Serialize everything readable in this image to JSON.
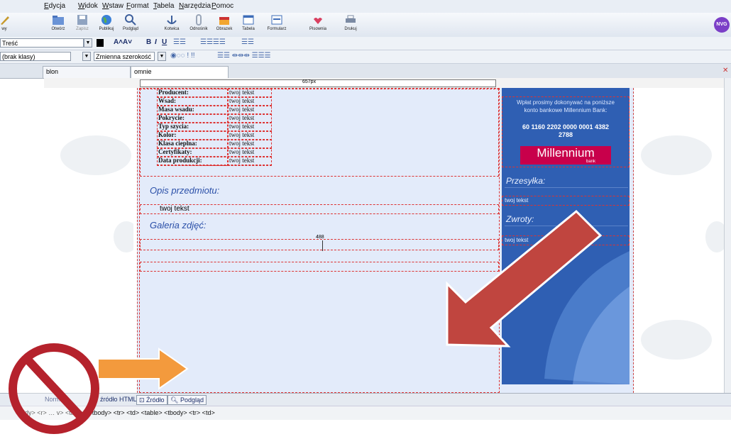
{
  "menu": [
    "Edycja",
    "Widok",
    "Wstaw",
    "Format",
    "Tabela",
    "Narzędzia",
    "Pomoc"
  ],
  "toolbar": {
    "items": [
      "Otwórz",
      "Zapisz",
      "Publikuj",
      "Podgląd",
      "Kotwica",
      "Odnośnik",
      "Obrazek",
      "Tabela",
      "Formularz",
      "Pisownia",
      "Drukuj"
    ],
    "partial_left": "wy",
    "user_badge": "NVG"
  },
  "format": {
    "paragraph_style": "Treść",
    "class_select": "(brak klasy)",
    "width_select": "Zmienna szerokość"
  },
  "tabs": [
    "blon",
    "omnie"
  ],
  "ruler": {
    "width_label": "657px",
    "cell_label": "488"
  },
  "product_specs": [
    {
      "label": "Producent:",
      "value": "twoj tekst"
    },
    {
      "label": "Wsad:",
      "value": "twoj tekst"
    },
    {
      "label": "Masa wsadu:",
      "value": "twoj tekst"
    },
    {
      "label": "Pokrycie:",
      "value": "twoj tekst"
    },
    {
      "label": "Typ szycia:",
      "value": "twoj tekst"
    },
    {
      "label": "Kolor:",
      "value": "twoj tekst"
    },
    {
      "label": "Klasa cieplna:",
      "value": "twoj tekst"
    },
    {
      "label": "Certyfikaty:",
      "value": "twoj tekst"
    },
    {
      "label": "Data produkcji:",
      "value": "twoj tekst"
    }
  ],
  "main": {
    "description_title": "Opis przedmiotu:",
    "description_text": "twoj tekst",
    "gallery_title": "Galeria zdjęć:"
  },
  "sidebar": {
    "payment_text_1": "Wpłat prosimy dokonywać na poniższe",
    "payment_text_2": "konto bankowe Millennium Bank:",
    "account_1": "60 1160 2202 0000 0001 4382",
    "account_2": "2788",
    "bank_logo": "Millennium",
    "bank_sub": "bank",
    "shipping_title": "Przesyłka:",
    "shipping_text": "twoj tekst",
    "returns_title": "Zwroty:",
    "returns_text": "twoj tekst"
  },
  "view_tabs": [
    "Norm",
    "źródło HTML",
    "Źródło",
    "Podgląd"
  ],
  "status_path": "ody> <r> … v> <table> <tbody> <tr> <td> <table> <tbody> <tr> <td>",
  "colors": {
    "page_bg": "#e3ebfa",
    "sidebar_blue": "#2f5fb3",
    "bank_red": "#c8004b",
    "arrow_red": "#c0453f",
    "arrow_orange": "#f39a3d",
    "no_sign": "#b5222c"
  }
}
